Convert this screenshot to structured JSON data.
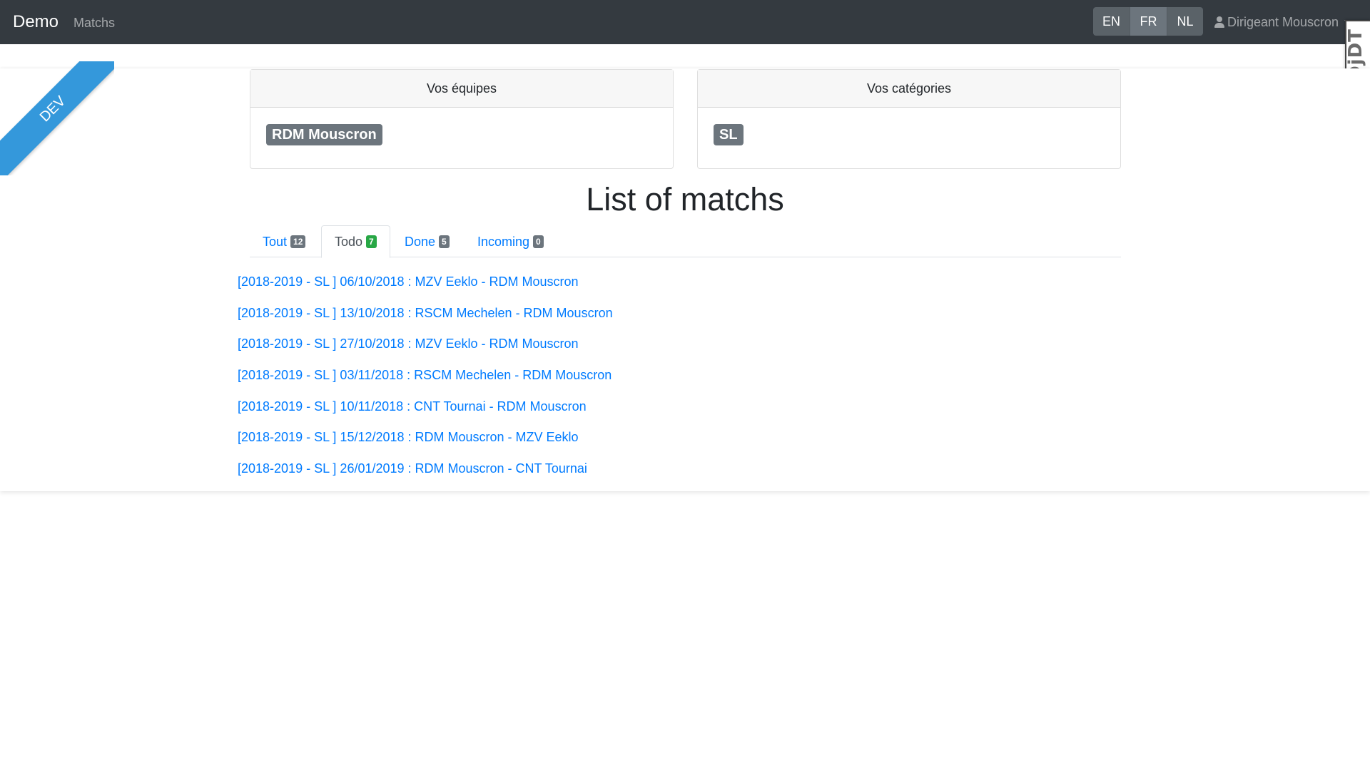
{
  "navbar": {
    "brand": "Demo",
    "nav_link": "Matchs",
    "languages": [
      "EN",
      "FR",
      "NL"
    ],
    "user": "Dirigeant Mouscron"
  },
  "debug_toolbar": {
    "label": "DjDT"
  },
  "ribbon": {
    "label": "DEV"
  },
  "teams_card": {
    "title": "Vos équipes",
    "badge": "RDM Mouscron"
  },
  "categories_card": {
    "title": "Vos catégories",
    "badge": "SL"
  },
  "page_title": "List of matchs",
  "tabs": [
    {
      "label": "Tout",
      "count": "12"
    },
    {
      "label": "Todo",
      "count": "7"
    },
    {
      "label": "Done",
      "count": "5"
    },
    {
      "label": "Incoming",
      "count": "0"
    }
  ],
  "matches": [
    "[2018-2019 - SL ] 06/10/2018 : MZV Eeklo - RDM Mouscron",
    "[2018-2019 - SL ] 13/10/2018 : RSCM Mechelen - RDM Mouscron",
    "[2018-2019 - SL ] 27/10/2018 : MZV Eeklo - RDM Mouscron",
    "[2018-2019 - SL ] 03/11/2018 : RSCM Mechelen - RDM Mouscron",
    "[2018-2019 - SL ] 10/11/2018 : CNT Tournai - RDM Mouscron",
    "[2018-2019 - SL ] 15/12/2018 : RDM Mouscron - MZV Eeklo",
    "[2018-2019 - SL ] 26/01/2019 : RDM Mouscron - CNT Tournai"
  ],
  "colors": {
    "navbar": "#343a40",
    "link": "#007bff",
    "ribbon": "#3498db",
    "badge": "#6c757d",
    "badge_success": "#28a745"
  }
}
